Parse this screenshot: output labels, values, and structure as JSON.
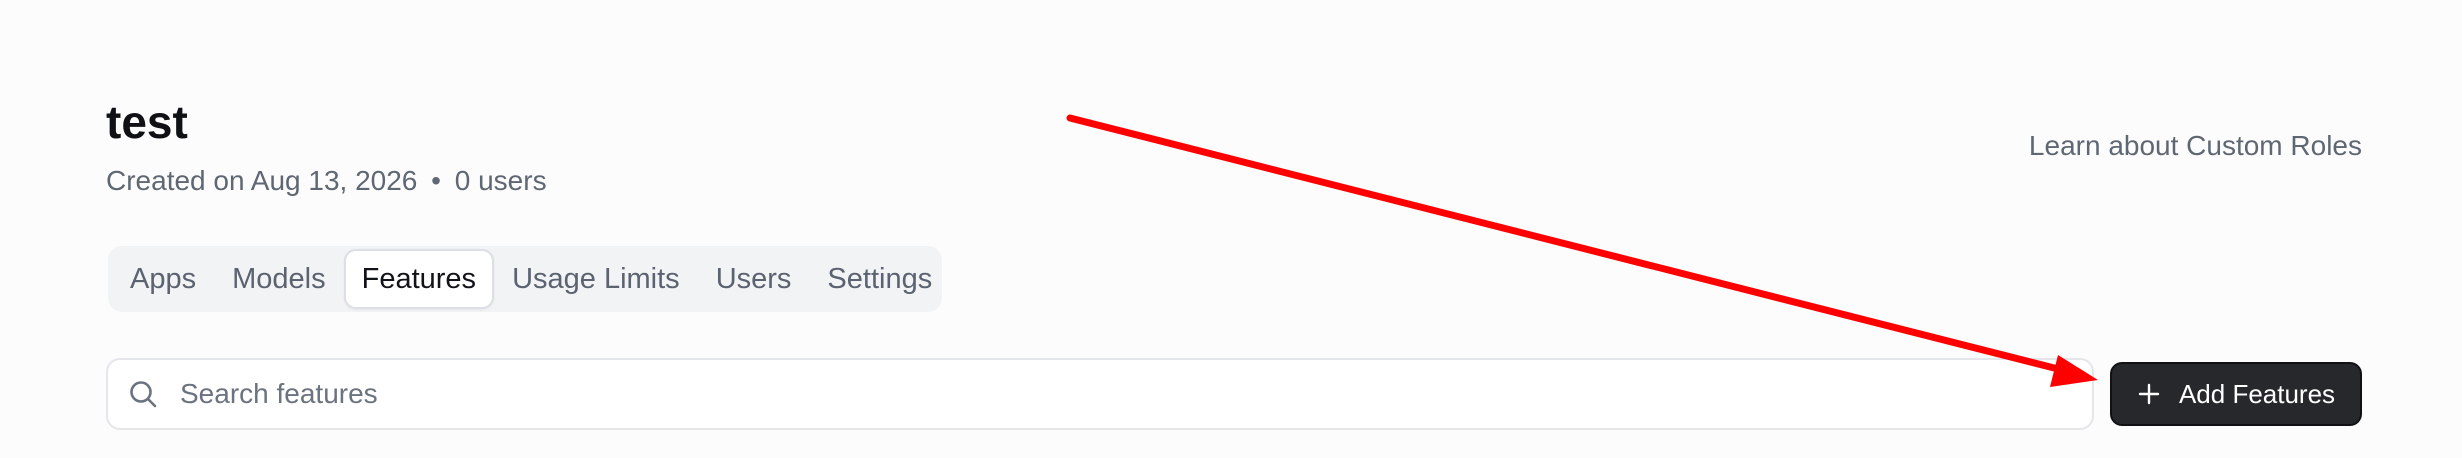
{
  "role": {
    "title": "test",
    "created": "Created on Aug 13, 2026",
    "separator": "•",
    "users": "0 users"
  },
  "header": {
    "learn_link": "Learn about Custom Roles"
  },
  "tabs": [
    {
      "label": "Apps"
    },
    {
      "label": "Models"
    },
    {
      "label": "Features"
    },
    {
      "label": "Usage Limits"
    },
    {
      "label": "Users"
    },
    {
      "label": "Settings"
    }
  ],
  "active_tab": "Features",
  "search": {
    "placeholder": "Search features",
    "value": ""
  },
  "actions": {
    "add_features_label": "Add Features"
  },
  "icons": {
    "search": "search-icon",
    "add": "plus-icon"
  },
  "colors": {
    "background": "#fcfcfd",
    "primary_button": "#27282b",
    "muted_text": "#5f6773",
    "annotation": "#ff0000"
  }
}
